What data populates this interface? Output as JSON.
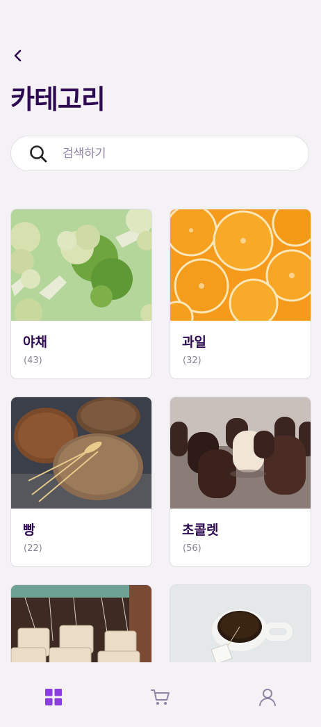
{
  "header": {
    "title": "카테고리"
  },
  "search": {
    "placeholder": "검색하기"
  },
  "categories": [
    {
      "name": "야채",
      "count": "(43)"
    },
    {
      "name": "과일",
      "count": "(32)"
    },
    {
      "name": "빵",
      "count": "(22)"
    },
    {
      "name": "초콜렛",
      "count": "(56)"
    }
  ],
  "colors": {
    "title": "#2d0a52",
    "accent": "#8b3ee0",
    "icon_inactive": "#8f84a6"
  },
  "icons": {
    "back": "chevron-left-icon",
    "search": "search-icon",
    "tab_categories": "grid-icon",
    "tab_cart": "cart-icon",
    "tab_profile": "user-icon"
  }
}
